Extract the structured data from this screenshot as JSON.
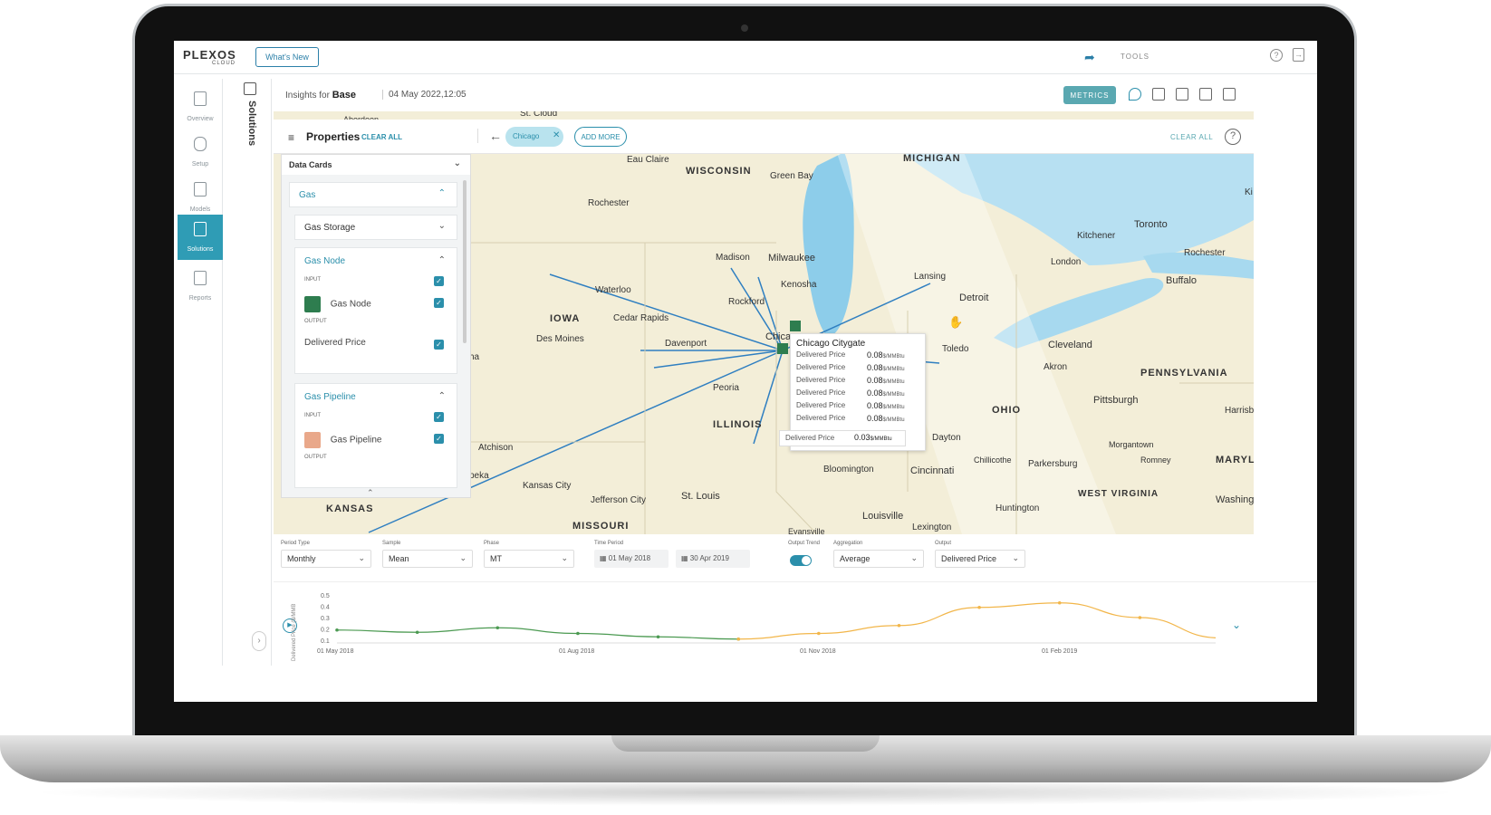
{
  "app": {
    "logo": "PLEXOS",
    "logo_sub": "CLOUD",
    "whats_new": "What's New",
    "tools": "TOOLS"
  },
  "leftnav": {
    "items": [
      {
        "label": "Overview"
      },
      {
        "label": "Setup"
      },
      {
        "label": "Models"
      },
      {
        "label": "Solutions",
        "active": true
      },
      {
        "label": "Reports"
      }
    ]
  },
  "solutions_panel": {
    "title": "Solutions"
  },
  "insights": {
    "prefix": "Insights for",
    "name": "Base",
    "date": "04 May 2022,12:05",
    "metrics": "METRICS"
  },
  "properties": {
    "title": "Properties",
    "clear_all": "CLEAR ALL",
    "chip": "Chicago",
    "add_more": "ADD MORE",
    "clear_all_right": "CLEAR ALL"
  },
  "data_cards": {
    "title": "Data Cards",
    "gas": "Gas",
    "gas_storage": "Gas Storage",
    "gas_node": {
      "title": "Gas Node",
      "input": "INPUT",
      "item": "Gas Node",
      "output": "OUTPUT",
      "output_item": "Delivered Price"
    },
    "gas_pipeline": {
      "title": "Gas Pipeline",
      "input": "INPUT",
      "item": "Gas Pipeline",
      "output": "OUTPUT"
    }
  },
  "map_labels": [
    {
      "text": "St. Cloud"
    },
    {
      "text": "WISCONSIN"
    },
    {
      "text": "MICHIGAN"
    },
    {
      "text": "Eau Claire"
    },
    {
      "text": "Green Bay"
    },
    {
      "text": "Rochester"
    },
    {
      "text": "Madison"
    },
    {
      "text": "Milwaukee"
    },
    {
      "text": "Kenosha"
    },
    {
      "text": "Waterloo"
    },
    {
      "text": "Rockford"
    },
    {
      "text": "IOWA"
    },
    {
      "text": "Cedar Rapids"
    },
    {
      "text": "Des Moines"
    },
    {
      "text": "Davenport"
    },
    {
      "text": "Peoria"
    },
    {
      "text": "ILLINOIS"
    },
    {
      "text": "Chicag"
    },
    {
      "text": "Lansing"
    },
    {
      "text": "Detroit"
    },
    {
      "text": "Toledo"
    },
    {
      "text": "Toronto"
    },
    {
      "text": "Kitchener"
    },
    {
      "text": "London"
    },
    {
      "text": "Rochester"
    },
    {
      "text": "Buffalo"
    },
    {
      "text": "Cleveland"
    },
    {
      "text": "Akron"
    },
    {
      "text": "PENNSYLVANIA"
    },
    {
      "text": "Pittsburgh"
    },
    {
      "text": "OHIO"
    },
    {
      "text": "Dayton"
    },
    {
      "text": "Harrisb"
    },
    {
      "text": "Morgantown"
    },
    {
      "text": "Chillicothe"
    },
    {
      "text": "Parkersburg"
    },
    {
      "text": "Romney"
    },
    {
      "text": "MARYL"
    },
    {
      "text": "WEST VIRGINIA"
    },
    {
      "text": "Washing"
    },
    {
      "text": "Huntington"
    },
    {
      "text": "Cincinnati"
    },
    {
      "text": "Bloomington"
    },
    {
      "text": "Louisville"
    },
    {
      "text": "Lexington"
    },
    {
      "text": "Evansville"
    },
    {
      "text": "St. Louis"
    },
    {
      "text": "Jefferson City"
    },
    {
      "text": "Kansas City"
    },
    {
      "text": "Atchison"
    },
    {
      "text": "peka"
    },
    {
      "text": "KANSAS"
    },
    {
      "text": "MISSOURI"
    },
    {
      "text": "ha"
    },
    {
      "text": "Ki"
    },
    {
      "text": "Aberdeen"
    }
  ],
  "tooltip": {
    "title": "Chicago Citygate",
    "rows": [
      {
        "label": "Delivered Price",
        "value": "0.08",
        "unit": "$/MMBtu"
      },
      {
        "label": "Delivered Price",
        "value": "0.08",
        "unit": "$/MMBtu"
      },
      {
        "label": "Delivered Price",
        "value": "0.08",
        "unit": "$/MMBtu"
      },
      {
        "label": "Delivered Price",
        "value": "0.08",
        "unit": "$/MMBtu"
      },
      {
        "label": "Delivered Price",
        "value": "0.08",
        "unit": "$/MMBtu"
      },
      {
        "label": "Delivered Price",
        "value": "0.08",
        "unit": "$/MMBtu"
      }
    ],
    "second": {
      "label": "Delivered Price",
      "value": "0.03",
      "unit": "$/MMBtu"
    }
  },
  "controls": {
    "period_type": {
      "label": "Period Type",
      "value": "Monthly"
    },
    "sample": {
      "label": "Sample",
      "value": "Mean"
    },
    "phase": {
      "label": "Phase",
      "value": "MT"
    },
    "time_period": {
      "label": "Time Period",
      "from": "01 May 2018",
      "to": "30 Apr 2019"
    },
    "output_trend": {
      "label": "Output Trend"
    },
    "aggregation": {
      "label": "Aggregation",
      "value": "Average"
    },
    "output": {
      "label": "Output",
      "value": "Delivered Price"
    }
  },
  "chart_data": {
    "type": "line",
    "ylabel": "Delivered Price ($/MMB",
    "yticks": [
      "0.5",
      "0.4",
      "0.3",
      "0.2",
      "0.1"
    ],
    "ylim": [
      0.1,
      0.5
    ],
    "xticks": [
      "01 May 2018",
      "01 Aug 2018",
      "01 Nov 2018",
      "01 Feb 2019"
    ],
    "series": [
      {
        "values": [
          0.19,
          0.17,
          0.21,
          0.16,
          0.13,
          0.11
        ]
      },
      {
        "values": [
          0.11,
          0.16,
          0.23,
          0.39,
          0.43,
          0.3,
          0.12
        ]
      }
    ],
    "colors": [
      "#4c9a52",
      "#f2b64a"
    ]
  }
}
